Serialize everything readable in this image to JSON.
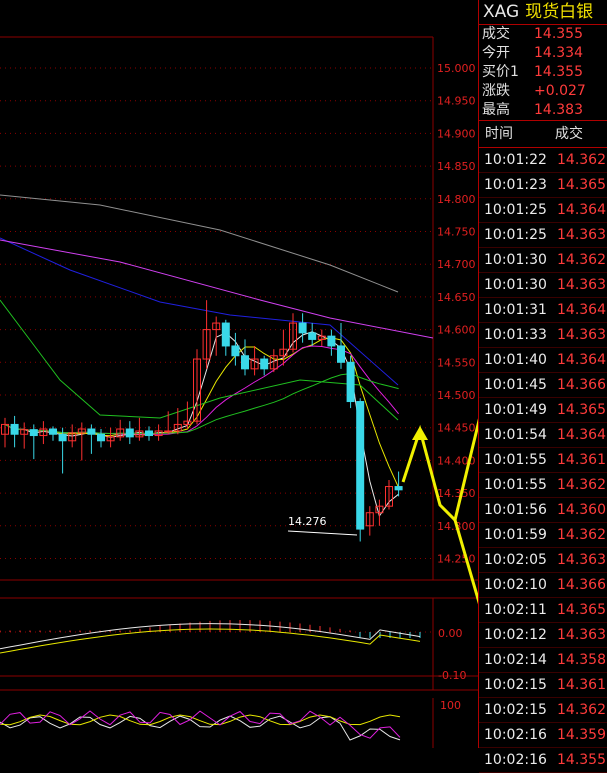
{
  "quote": {
    "symbol": "XAG",
    "name": "现货白银",
    "rows": [
      {
        "label": "成交",
        "value": "14.355"
      },
      {
        "label": "今开",
        "value": "14.334"
      },
      {
        "label": "买价1",
        "value": "14.355"
      },
      {
        "label": "涨跌",
        "value": "+0.027"
      },
      {
        "label": "最高",
        "value": "14.383"
      }
    ]
  },
  "ticks": {
    "header_time": "时间",
    "header_price": "成交",
    "rows": [
      {
        "time": "10:01:22",
        "price": "14.362"
      },
      {
        "time": "10:01:23",
        "price": "14.365"
      },
      {
        "time": "10:01:25",
        "price": "14.364"
      },
      {
        "time": "10:01:25",
        "price": "14.363"
      },
      {
        "time": "10:01:30",
        "price": "14.362"
      },
      {
        "time": "10:01:30",
        "price": "14.363"
      },
      {
        "time": "10:01:31",
        "price": "14.364"
      },
      {
        "time": "10:01:33",
        "price": "14.363"
      },
      {
        "time": "10:01:40",
        "price": "14.364"
      },
      {
        "time": "10:01:45",
        "price": "14.366"
      },
      {
        "time": "10:01:49",
        "price": "14.365"
      },
      {
        "time": "10:01:54",
        "price": "14.364"
      },
      {
        "time": "10:01:55",
        "price": "14.361"
      },
      {
        "time": "10:01:55",
        "price": "14.362"
      },
      {
        "time": "10:01:56",
        "price": "14.360"
      },
      {
        "time": "10:01:59",
        "price": "14.362"
      },
      {
        "time": "10:02:05",
        "price": "14.363"
      },
      {
        "time": "10:02:10",
        "price": "14.366"
      },
      {
        "time": "10:02:11",
        "price": "14.365"
      },
      {
        "time": "10:02:12",
        "price": "14.363"
      },
      {
        "time": "10:02:14",
        "price": "14.358"
      },
      {
        "time": "10:02:15",
        "price": "14.361"
      },
      {
        "time": "10:02:15",
        "price": "14.362"
      },
      {
        "time": "10:02:16",
        "price": "14.359"
      },
      {
        "time": "10:02:16",
        "price": "14.355"
      }
    ]
  },
  "chart": {
    "price_ticks": [
      "15.000",
      "14.950",
      "14.900",
      "14.850",
      "14.800",
      "14.750",
      "14.700",
      "14.650",
      "14.600",
      "14.550",
      "14.500",
      "14.450",
      "14.400",
      "14.350",
      "14.300",
      "14.250"
    ],
    "price_ylim": [
      14.25,
      15.0
    ],
    "low_label": "14.276",
    "macd_zero_label": "0.00",
    "macd_low_label": "-0.10",
    "osc_top_label": "100",
    "candles": [
      {
        "o": 14.44,
        "c": 14.455,
        "h": 14.465,
        "l": 14.42
      },
      {
        "o": 14.455,
        "c": 14.44,
        "h": 14.468,
        "l": 14.42
      },
      {
        "o": 14.44,
        "c": 14.447,
        "h": 14.458,
        "l": 14.418
      },
      {
        "o": 14.447,
        "c": 14.438,
        "h": 14.455,
        "l": 14.402
      },
      {
        "o": 14.438,
        "c": 14.448,
        "h": 14.46,
        "l": 14.425
      },
      {
        "o": 14.448,
        "c": 14.44,
        "h": 14.452,
        "l": 14.43
      },
      {
        "o": 14.44,
        "c": 14.43,
        "h": 14.45,
        "l": 14.38
      },
      {
        "o": 14.43,
        "c": 14.442,
        "h": 14.455,
        "l": 14.42
      },
      {
        "o": 14.442,
        "c": 14.448,
        "h": 14.458,
        "l": 14.4
      },
      {
        "o": 14.448,
        "c": 14.44,
        "h": 14.455,
        "l": 14.41
      },
      {
        "o": 14.44,
        "c": 14.43,
        "h": 14.448,
        "l": 14.42
      },
      {
        "o": 14.43,
        "c": 14.436,
        "h": 14.45,
        "l": 14.42
      },
      {
        "o": 14.436,
        "c": 14.448,
        "h": 14.462,
        "l": 14.43
      },
      {
        "o": 14.448,
        "c": 14.436,
        "h": 14.46,
        "l": 14.425
      },
      {
        "o": 14.436,
        "c": 14.445,
        "h": 14.465,
        "l": 14.43
      },
      {
        "o": 14.445,
        "c": 14.438,
        "h": 14.452,
        "l": 14.43
      },
      {
        "o": 14.438,
        "c": 14.445,
        "h": 14.455,
        "l": 14.43
      },
      {
        "o": 14.445,
        "c": 14.445,
        "h": 14.475,
        "l": 14.44
      },
      {
        "o": 14.445,
        "c": 14.455,
        "h": 14.48,
        "l": 14.44
      },
      {
        "o": 14.455,
        "c": 14.46,
        "h": 14.49,
        "l": 14.448
      },
      {
        "o": 14.46,
        "c": 14.555,
        "h": 14.57,
        "l": 14.455
      },
      {
        "o": 14.555,
        "c": 14.6,
        "h": 14.645,
        "l": 14.54
      },
      {
        "o": 14.6,
        "c": 14.61,
        "h": 14.62,
        "l": 14.56
      },
      {
        "o": 14.61,
        "c": 14.575,
        "h": 14.615,
        "l": 14.56
      },
      {
        "o": 14.575,
        "c": 14.56,
        "h": 14.595,
        "l": 14.545
      },
      {
        "o": 14.56,
        "c": 14.54,
        "h": 14.585,
        "l": 14.53
      },
      {
        "o": 14.54,
        "c": 14.555,
        "h": 14.575,
        "l": 14.53
      },
      {
        "o": 14.555,
        "c": 14.54,
        "h": 14.56,
        "l": 14.53
      },
      {
        "o": 14.54,
        "c": 14.56,
        "h": 14.57,
        "l": 14.535
      },
      {
        "o": 14.56,
        "c": 14.57,
        "h": 14.6,
        "l": 14.545
      },
      {
        "o": 14.57,
        "c": 14.61,
        "h": 14.625,
        "l": 14.565
      },
      {
        "o": 14.61,
        "c": 14.595,
        "h": 14.625,
        "l": 14.58
      },
      {
        "o": 14.595,
        "c": 14.585,
        "h": 14.61,
        "l": 14.575
      },
      {
        "o": 14.585,
        "c": 14.59,
        "h": 14.6,
        "l": 14.575
      },
      {
        "o": 14.59,
        "c": 14.575,
        "h": 14.6,
        "l": 14.56
      },
      {
        "o": 14.575,
        "c": 14.55,
        "h": 14.61,
        "l": 14.54
      },
      {
        "o": 14.55,
        "c": 14.49,
        "h": 14.56,
        "l": 14.48
      },
      {
        "o": 14.49,
        "c": 14.295,
        "h": 14.495,
        "l": 14.276
      },
      {
        "o": 14.3,
        "c": 14.32,
        "h": 14.33,
        "l": 14.285
      },
      {
        "o": 14.32,
        "c": 14.33,
        "h": 14.34,
        "l": 14.3
      },
      {
        "o": 14.33,
        "c": 14.36,
        "h": 14.37,
        "l": 14.325
      },
      {
        "o": 14.36,
        "c": 14.355,
        "h": 14.383,
        "l": 14.345
      }
    ],
    "colors": {
      "up": "#ff3030",
      "down": "#3ad8e8",
      "grid": "#8b0000",
      "axis_text": "#e02020",
      "ma_white": "#e8e8e8",
      "ma_yellow": "#e8e800",
      "ma_magenta": "#e020e0",
      "ma_green": "#20c020",
      "ma_blue": "#2020e0",
      "ma_gray": "#909090",
      "ma_violet": "#d040f0",
      "arrow": "#f0f000"
    }
  }
}
